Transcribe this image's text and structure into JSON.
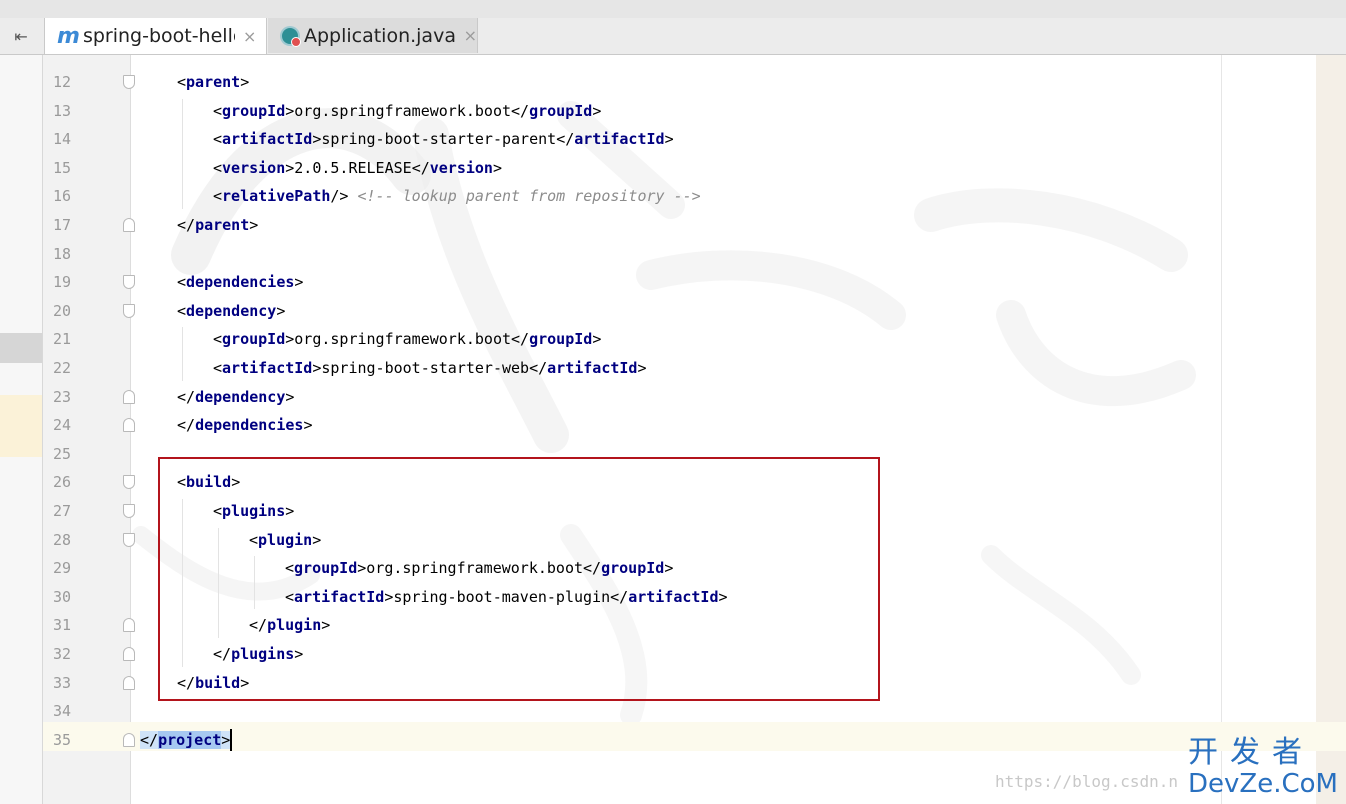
{
  "tabs": [
    {
      "icon": "maven-m-icon",
      "label": "spring-boot-hello",
      "active": true
    },
    {
      "icon": "java-class-icon",
      "label": "Application.java",
      "active": false
    }
  ],
  "tab_close_glyph": "×",
  "sidebar_toggle_glyph": "⇤",
  "maven_glyph": "m",
  "lines": [
    {
      "n": "12",
      "depth": 1,
      "fold": "open",
      "tokens": [
        [
          "br",
          "<"
        ],
        [
          "tag",
          "parent"
        ],
        [
          "br",
          ">"
        ]
      ]
    },
    {
      "n": "13",
      "depth": 2,
      "fold": "",
      "tokens": [
        [
          "br",
          "<"
        ],
        [
          "tag",
          "groupId"
        ],
        [
          "br",
          ">"
        ],
        [
          "txt",
          "org.springframework.boot"
        ],
        [
          "br",
          "</"
        ],
        [
          "tag",
          "groupId"
        ],
        [
          "br",
          ">"
        ]
      ]
    },
    {
      "n": "14",
      "depth": 2,
      "fold": "",
      "tokens": [
        [
          "br",
          "<"
        ],
        [
          "tag",
          "artifactId"
        ],
        [
          "br",
          ">"
        ],
        [
          "txt",
          "spring-boot-starter-parent"
        ],
        [
          "br",
          "</"
        ],
        [
          "tag",
          "artifactId"
        ],
        [
          "br",
          ">"
        ]
      ]
    },
    {
      "n": "15",
      "depth": 2,
      "fold": "",
      "tokens": [
        [
          "br",
          "<"
        ],
        [
          "tag",
          "version"
        ],
        [
          "br",
          ">"
        ],
        [
          "txt",
          "2.0.5.RELEASE"
        ],
        [
          "br",
          "</"
        ],
        [
          "tag",
          "version"
        ],
        [
          "br",
          ">"
        ]
      ]
    },
    {
      "n": "16",
      "depth": 2,
      "fold": "",
      "tokens": [
        [
          "br",
          "<"
        ],
        [
          "tag",
          "relativePath"
        ],
        [
          "br",
          "/>"
        ],
        [
          "txt",
          " "
        ],
        [
          "cm",
          "<!-- lookup parent from repository -->"
        ]
      ]
    },
    {
      "n": "17",
      "depth": 1,
      "fold": "close",
      "tokens": [
        [
          "br",
          "</"
        ],
        [
          "tag",
          "parent"
        ],
        [
          "br",
          ">"
        ]
      ]
    },
    {
      "n": "18",
      "depth": 1,
      "fold": "",
      "tokens": []
    },
    {
      "n": "19",
      "depth": 1,
      "fold": "open",
      "tokens": [
        [
          "br",
          "<"
        ],
        [
          "tag",
          "dependencies"
        ],
        [
          "br",
          ">"
        ]
      ]
    },
    {
      "n": "20",
      "depth": 1,
      "fold": "open",
      "tokens": [
        [
          "br",
          "<"
        ],
        [
          "tag",
          "dependency"
        ],
        [
          "br",
          ">"
        ]
      ]
    },
    {
      "n": "21",
      "depth": 2,
      "fold": "",
      "tokens": [
        [
          "br",
          "<"
        ],
        [
          "tag",
          "groupId"
        ],
        [
          "br",
          ">"
        ],
        [
          "txt",
          "org.springframework.boot"
        ],
        [
          "br",
          "</"
        ],
        [
          "tag",
          "groupId"
        ],
        [
          "br",
          ">"
        ]
      ]
    },
    {
      "n": "22",
      "depth": 2,
      "fold": "",
      "tokens": [
        [
          "br",
          "<"
        ],
        [
          "tag",
          "artifactId"
        ],
        [
          "br",
          ">"
        ],
        [
          "txt",
          "spring-boot-starter-web"
        ],
        [
          "br",
          "</"
        ],
        [
          "tag",
          "artifactId"
        ],
        [
          "br",
          ">"
        ]
      ]
    },
    {
      "n": "23",
      "depth": 1,
      "fold": "close",
      "tokens": [
        [
          "br",
          "</"
        ],
        [
          "tag",
          "dependency"
        ],
        [
          "br",
          ">"
        ]
      ]
    },
    {
      "n": "24",
      "depth": 1,
      "fold": "close",
      "tokens": [
        [
          "br",
          "</"
        ],
        [
          "tag",
          "dependencies"
        ],
        [
          "br",
          ">"
        ]
      ]
    },
    {
      "n": "25",
      "depth": 1,
      "fold": "",
      "tokens": []
    },
    {
      "n": "26",
      "depth": 1,
      "fold": "open",
      "tokens": [
        [
          "br",
          "<"
        ],
        [
          "tag",
          "build"
        ],
        [
          "br",
          ">"
        ]
      ]
    },
    {
      "n": "27",
      "depth": 2,
      "fold": "open",
      "tokens": [
        [
          "br",
          "<"
        ],
        [
          "tag",
          "plugins"
        ],
        [
          "br",
          ">"
        ]
      ]
    },
    {
      "n": "28",
      "depth": 3,
      "fold": "open",
      "tokens": [
        [
          "br",
          "<"
        ],
        [
          "tag",
          "plugin"
        ],
        [
          "br",
          ">"
        ]
      ]
    },
    {
      "n": "29",
      "depth": 4,
      "fold": "",
      "tokens": [
        [
          "br",
          "<"
        ],
        [
          "tag",
          "groupId"
        ],
        [
          "br",
          ">"
        ],
        [
          "txt",
          "org.springframework.boot"
        ],
        [
          "br",
          "</"
        ],
        [
          "tag",
          "groupId"
        ],
        [
          "br",
          ">"
        ]
      ]
    },
    {
      "n": "30",
      "depth": 4,
      "fold": "",
      "tokens": [
        [
          "br",
          "<"
        ],
        [
          "tag",
          "artifactId"
        ],
        [
          "br",
          ">"
        ],
        [
          "txt",
          "spring-boot-maven-plugin"
        ],
        [
          "br",
          "</"
        ],
        [
          "tag",
          "artifactId"
        ],
        [
          "br",
          ">"
        ]
      ]
    },
    {
      "n": "31",
      "depth": 3,
      "fold": "close",
      "tokens": [
        [
          "br",
          "</"
        ],
        [
          "tag",
          "plugin"
        ],
        [
          "br",
          ">"
        ]
      ]
    },
    {
      "n": "32",
      "depth": 2,
      "fold": "close",
      "tokens": [
        [
          "br",
          "</"
        ],
        [
          "tag",
          "plugins"
        ],
        [
          "br",
          ">"
        ]
      ]
    },
    {
      "n": "33",
      "depth": 1,
      "fold": "close",
      "tokens": [
        [
          "br",
          "</"
        ],
        [
          "tag",
          "build"
        ],
        [
          "br",
          ">"
        ]
      ]
    },
    {
      "n": "34",
      "depth": 0,
      "fold": "",
      "tokens": []
    },
    {
      "n": "35",
      "depth": 0,
      "fold": "close",
      "selected": true,
      "tokens": [
        [
          "br",
          "</"
        ],
        [
          "tag",
          "project"
        ],
        [
          "br",
          ">"
        ]
      ]
    }
  ],
  "watermark": {
    "url": "https://blog.csdn.n",
    "brand_cn": "开发者",
    "brand_en": "DevZe.CoM"
  },
  "colors": {
    "tag": "#000080",
    "highlight_box": "#b3141c",
    "brand": "#2970bf"
  }
}
